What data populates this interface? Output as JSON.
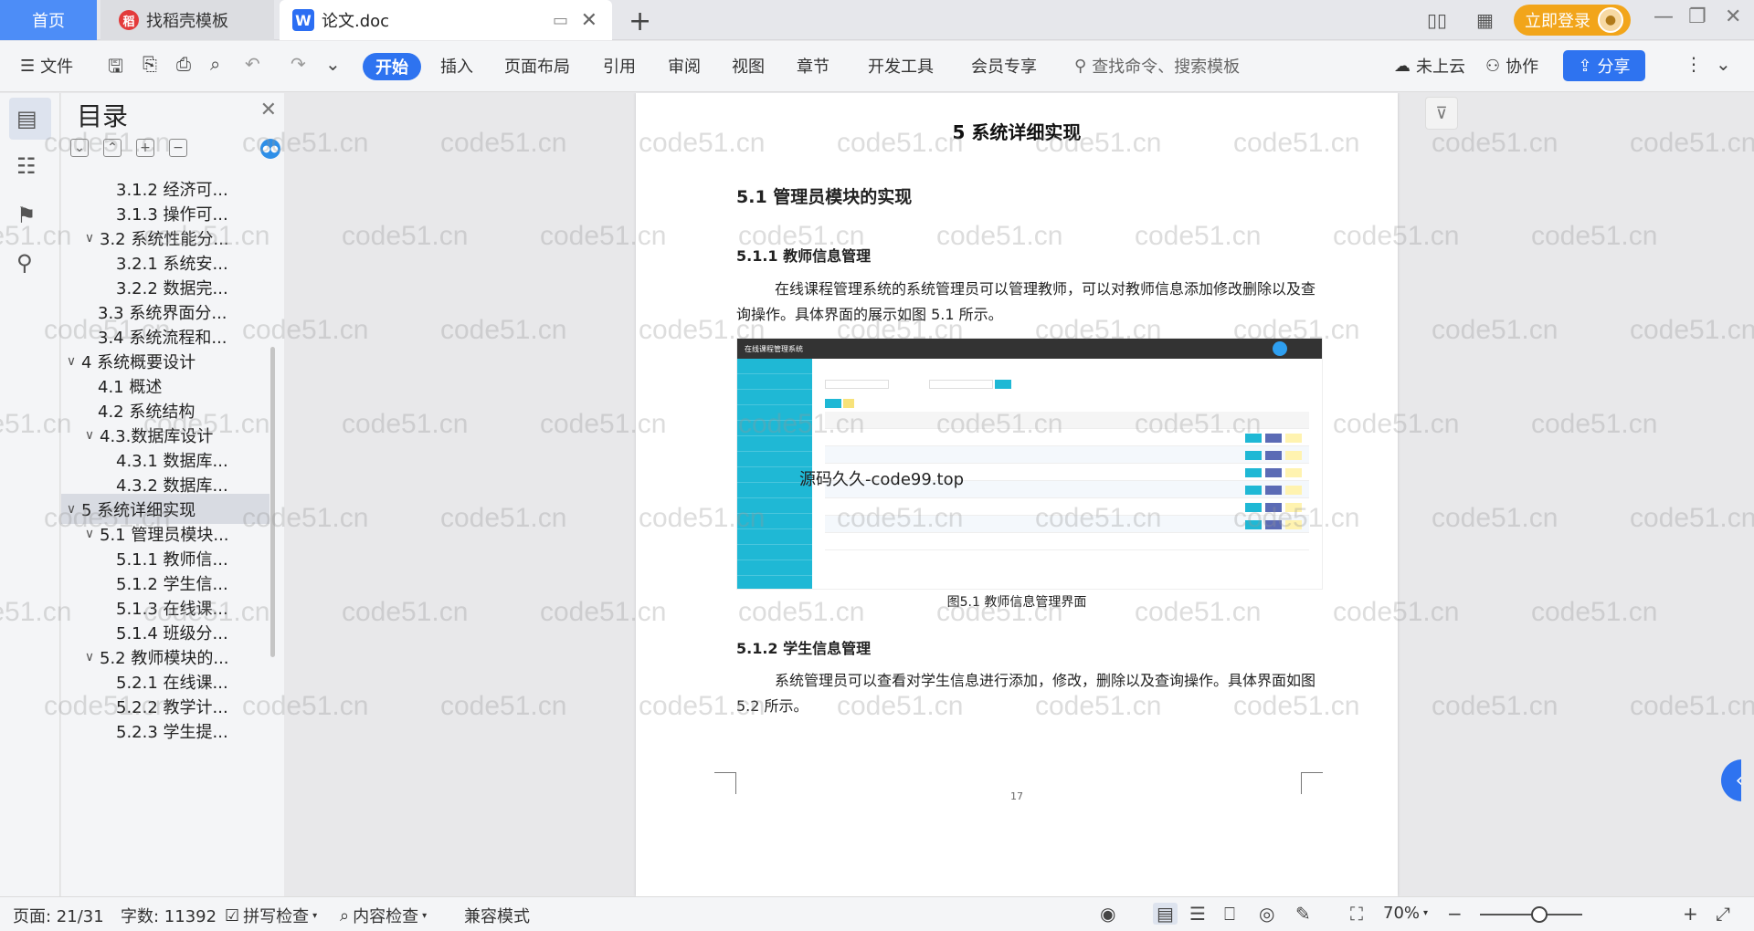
{
  "titlebar": {
    "home_tab": "首页",
    "template_tab": "找稻壳模板",
    "doc_tab": "论文.doc",
    "login_button": "立即登录"
  },
  "ribbon": {
    "file_menu": "文件",
    "tabs": [
      "开始",
      "插入",
      "页面布局",
      "引用",
      "审阅",
      "视图",
      "章节",
      "开发工具",
      "会员专享"
    ],
    "search_placeholder": "查找命令、搜索模板",
    "cloud": "未上云",
    "collab": "协作",
    "share": "分享"
  },
  "toc": {
    "title": "目录",
    "items": [
      {
        "label": "3.1.2 经济可..."
      },
      {
        "label": "3.1.3 操作可..."
      },
      {
        "label": "3.2 系统性能分..."
      },
      {
        "label": "3.2.1  系统安..."
      },
      {
        "label": "3.2.2  数据完..."
      },
      {
        "label": "3.3 系统界面分..."
      },
      {
        "label": "3.4 系统流程和..."
      },
      {
        "label": "4 系统概要设计"
      },
      {
        "label": "4.1 概述"
      },
      {
        "label": "4.2 系统结构"
      },
      {
        "label": "4.3.数据库设计"
      },
      {
        "label": "4.3.1 数据库..."
      },
      {
        "label": "4.3.2 数据库..."
      },
      {
        "label": "5 系统详细实现"
      },
      {
        "label": "5.1  管理员模块..."
      },
      {
        "label": "5.1.1  教师信..."
      },
      {
        "label": "5.1.2  学生信..."
      },
      {
        "label": "5.1.3  在线课..."
      },
      {
        "label": "5.1.4  班级分..."
      },
      {
        "label": "5.2  教师模块的..."
      },
      {
        "label": "5.2.1  在线课..."
      },
      {
        "label": "5.2.2  教学计..."
      },
      {
        "label": "5.2.3  学生提..."
      }
    ]
  },
  "document": {
    "chapter_title": "5 系统详细实现",
    "section_title": "5.1  管理员模块的实现",
    "subsection1_title": "5.1.1  教师信息管理",
    "para1": "在线课程管理系统的系统管理员可以管理教师，可以对教师信息添加修改删除以及查询操作。具体界面的展示如图 5.1 所示。",
    "figure_app_title": "在线课程管理系统",
    "figure_overlay_text": "源码久久-code99.top",
    "figure_caption": "图5.1  教师信息管理界面",
    "subsection2_title": "5.1.2  学生信息管理",
    "para2": "系统管理员可以查看对学生信息进行添加，修改，删除以及查询操作。具体界面如图 5.2 所示。",
    "page_number": "17"
  },
  "watermark_text": "code51.cn",
  "statusbar": {
    "page": "页面: 21/31",
    "words": "字数: 11392",
    "spell_check": "拼写检查",
    "content_check": "内容检查",
    "compat_mode": "兼容模式",
    "zoom": "70%"
  },
  "colors": {
    "accent": "#2e73f0",
    "login": "#f2a51a",
    "figure_sidebar": "#1fb8d5"
  }
}
